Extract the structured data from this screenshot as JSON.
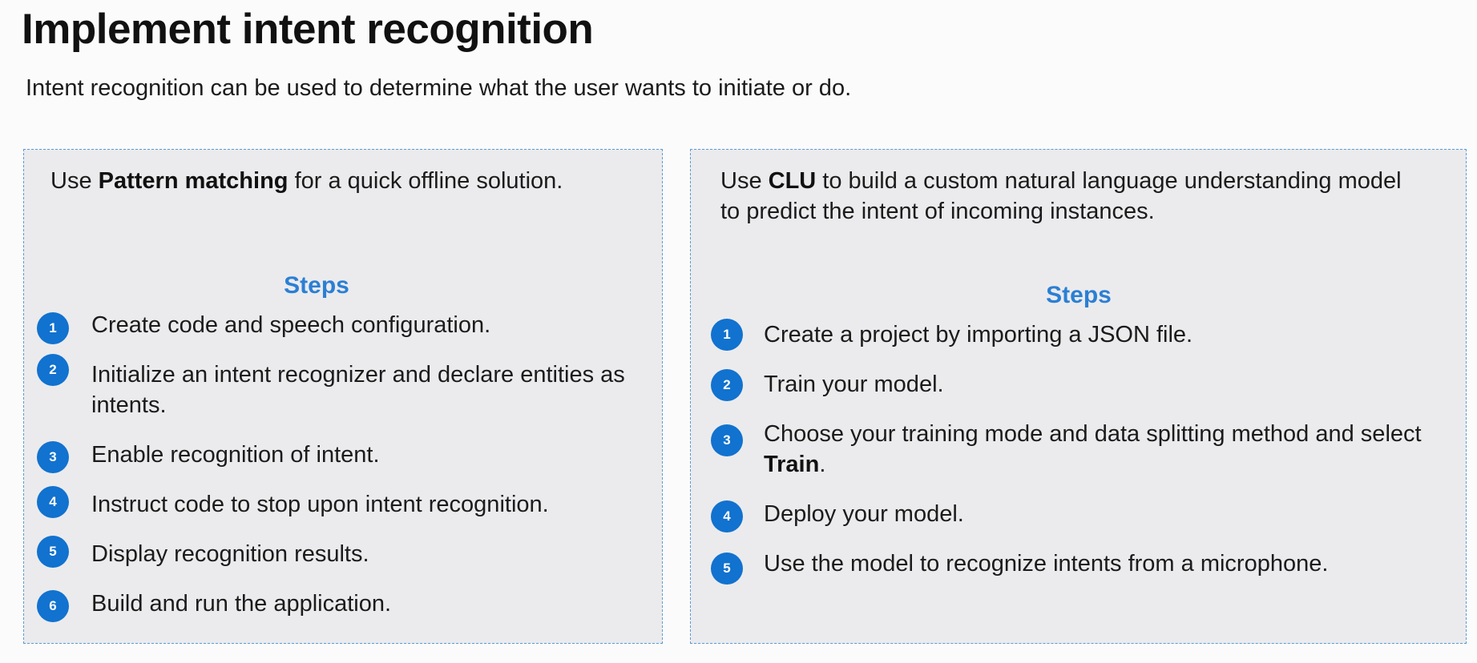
{
  "slide": {
    "title": "Implement intent recognition",
    "subtitle": "Intent recognition can be used to determine what the user wants to initiate or do."
  },
  "left_panel": {
    "intro_prefix": "Use ",
    "intro_bold": "Pattern matching",
    "intro_suffix": " for a quick offline solution.",
    "steps_heading": "Steps",
    "steps": [
      {
        "number": "1",
        "text": "Create code and speech configuration."
      },
      {
        "number": "2",
        "text": "Initialize an intent recognizer and declare entities as intents."
      },
      {
        "number": "3",
        "text": "Enable recognition of intent."
      },
      {
        "number": "4",
        "text": "Instruct code to stop upon intent recognition."
      },
      {
        "number": "5",
        "text": "Display recognition results."
      },
      {
        "number": "6",
        "text": "Build and run the application."
      }
    ]
  },
  "right_panel": {
    "intro_prefix": "Use ",
    "intro_bold": "CLU",
    "intro_suffix": " to build a custom natural language understanding model to predict the intent of incoming instances.",
    "steps_heading": "Steps",
    "steps": [
      {
        "number": "1",
        "text": "Create a project by importing a JSON file."
      },
      {
        "number": "2",
        "text": "Train your model."
      },
      {
        "number": "3",
        "text_prefix": "Choose your training mode and data splitting method and select ",
        "text_bold": "Train",
        "text_suffix": "."
      },
      {
        "number": "4",
        "text": "Deploy your model."
      },
      {
        "number": "5",
        "text": "Use the model to recognize intents from a microphone."
      }
    ]
  }
}
